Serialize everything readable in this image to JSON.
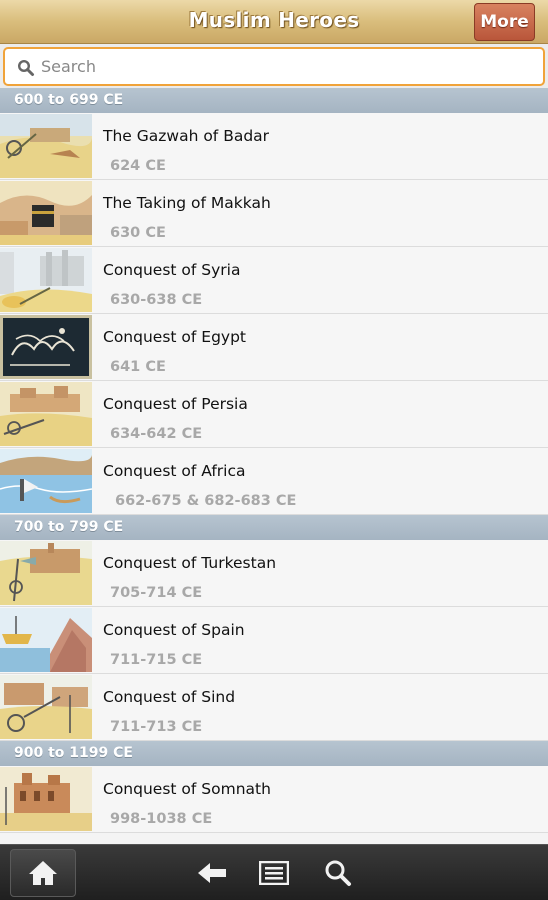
{
  "app": {
    "title": "Muslim Heroes",
    "more_label": "More"
  },
  "search": {
    "placeholder": "Search",
    "value": ""
  },
  "sections": [
    {
      "header": "600 to 699 CE",
      "items": [
        {
          "title": "The Gazwah of Badar",
          "date": "624 CE"
        },
        {
          "title": "The Taking of Makkah",
          "date": "630 CE"
        },
        {
          "title": "Conquest of Syria",
          "date": "630-638 CE"
        },
        {
          "title": "Conquest of Egypt",
          "date": "641 CE"
        },
        {
          "title": "Conquest of Persia",
          "date": "634-642 CE"
        },
        {
          "title": "Conquest of Africa",
          "date": "662-675 & 682-683 CE"
        }
      ]
    },
    {
      "header": "700 to 799 CE",
      "items": [
        {
          "title": "Conquest of Turkestan",
          "date": "705-714 CE"
        },
        {
          "title": "Conquest of Spain",
          "date": "711-715 CE"
        },
        {
          "title": "Conquest of Sind",
          "date": "711-713 CE"
        }
      ]
    },
    {
      "header": "900 to 1199 CE",
      "items": [
        {
          "title": "Conquest of Somnath",
          "date": "998-1038 CE"
        }
      ]
    }
  ],
  "toolbar": {
    "home_icon": "home-icon",
    "back_icon": "back-arrow-icon",
    "menu_icon": "list-menu-icon",
    "search_icon": "search-icon"
  }
}
